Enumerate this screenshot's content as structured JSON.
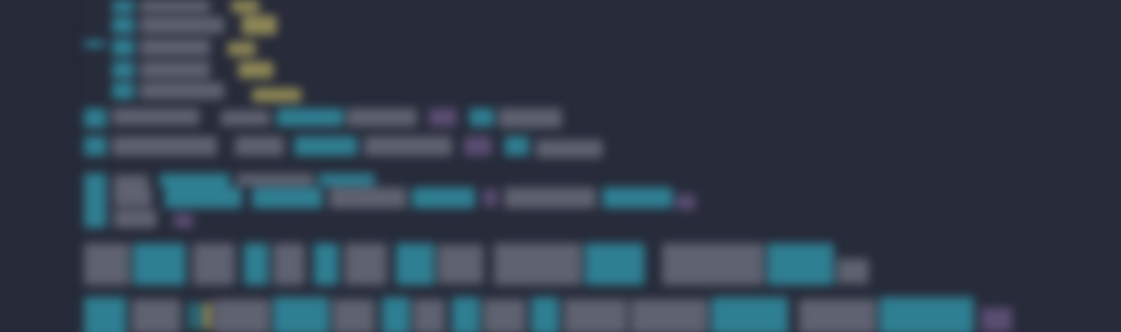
{
  "editor": {
    "theme": "dark",
    "background_color": "#272b3a",
    "content_state": "blurred",
    "visible_text": [],
    "token_colors": {
      "keyword": "#2f7f92",
      "identifier": "#5f6270",
      "string": "#8f8756",
      "operator": "#5a4d72"
    }
  }
}
